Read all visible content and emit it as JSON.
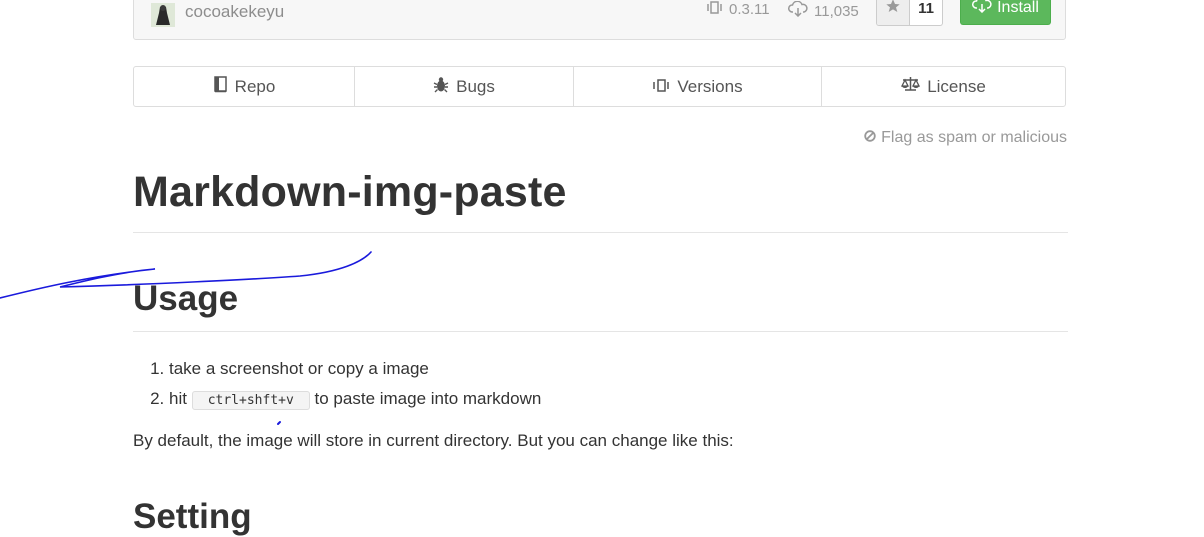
{
  "header": {
    "author": "cocoakekeyu",
    "version": "0.3.11",
    "downloads": "11,035",
    "stars": "11",
    "install_label": "Install",
    "icons": {
      "version": "versions-icon",
      "downloads": "cloud-download-icon",
      "star": "star-icon",
      "install": "cloud-download-icon"
    }
  },
  "tabs": [
    {
      "label": "Repo",
      "icon": "book-icon"
    },
    {
      "label": "Bugs",
      "icon": "bug-icon"
    },
    {
      "label": "Versions",
      "icon": "versions-icon"
    },
    {
      "label": "License",
      "icon": "scale-icon"
    }
  ],
  "flag_label": "Flag as spam or malicious",
  "readme": {
    "title": "Markdown-img-paste",
    "usage_heading": "Usage",
    "steps": [
      {
        "text": "take a screenshot or copy a image"
      },
      {
        "before": "hit",
        "code": "ctrl+shft+v",
        "after": "to paste image into markdown"
      }
    ],
    "description": "By default, the image will store in current directory. But you can change like this:",
    "setting_heading": "Setting"
  },
  "colors": {
    "install": "#5cb85c",
    "annotation_ink": "#1a1adc",
    "muted_text": "#999999",
    "heading": "#333333"
  }
}
